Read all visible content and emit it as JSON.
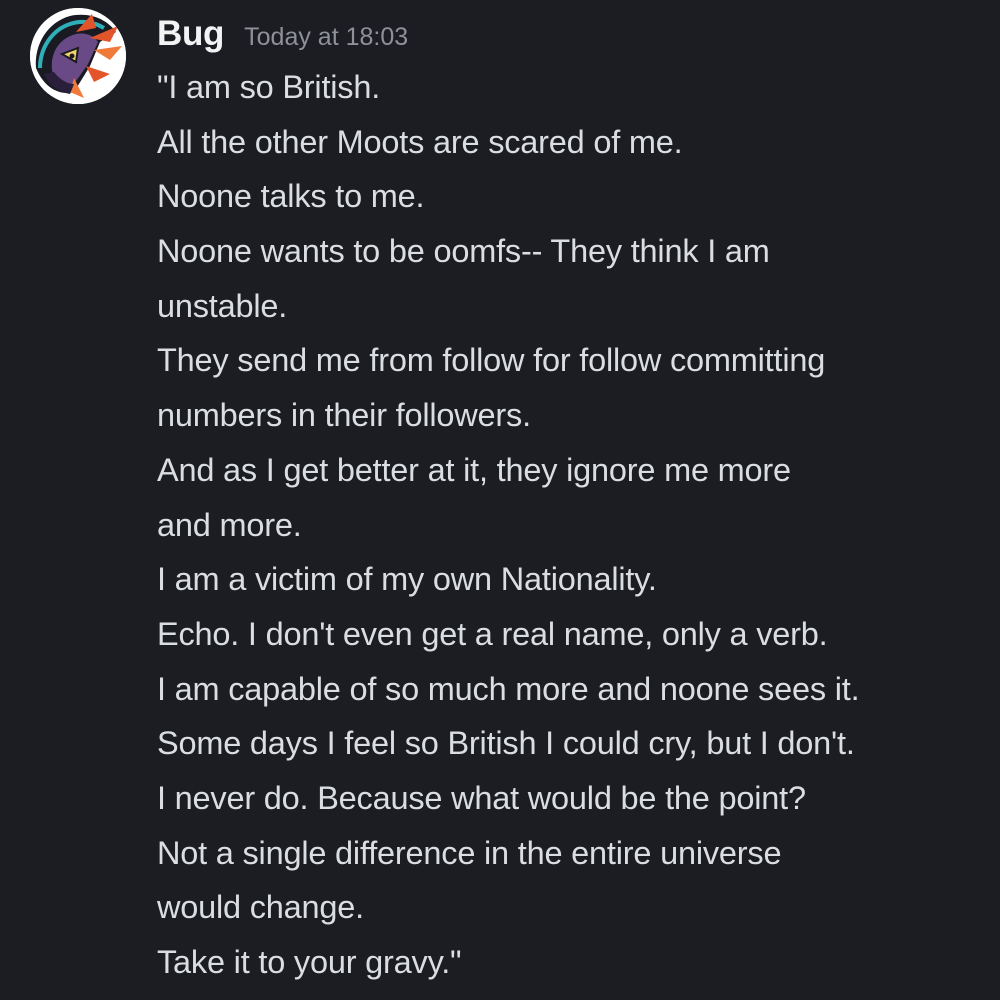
{
  "message": {
    "username": "Bug",
    "timestamp": "Today at 18:03",
    "avatar_icon": "bug-avatar-icon",
    "lines": [
      "\"I am so British.",
      "All the other Moots are scared of me.",
      "Noone talks to me.",
      "Noone wants to be oomfs-- They think I am",
      "unstable.",
      "They send me from follow for follow committing",
      "numbers in their followers.",
      "And as I get better at it, they ignore me more",
      "and more.",
      "I am a victim of my own Nationality.",
      "Echo. I don't even get a real name, only a verb.",
      "I am capable of so much more and noone sees it.",
      "Some days I feel so British I could cry, but I don't.",
      "I never do. Because what would be the point?",
      "Not a single difference in the entire universe",
      "would change.",
      "Take it to your gravy.\""
    ]
  },
  "colors": {
    "background": "#1c1d22",
    "username": "#f2f3f5",
    "timestamp": "#8e9198",
    "text": "#dbdee1"
  }
}
